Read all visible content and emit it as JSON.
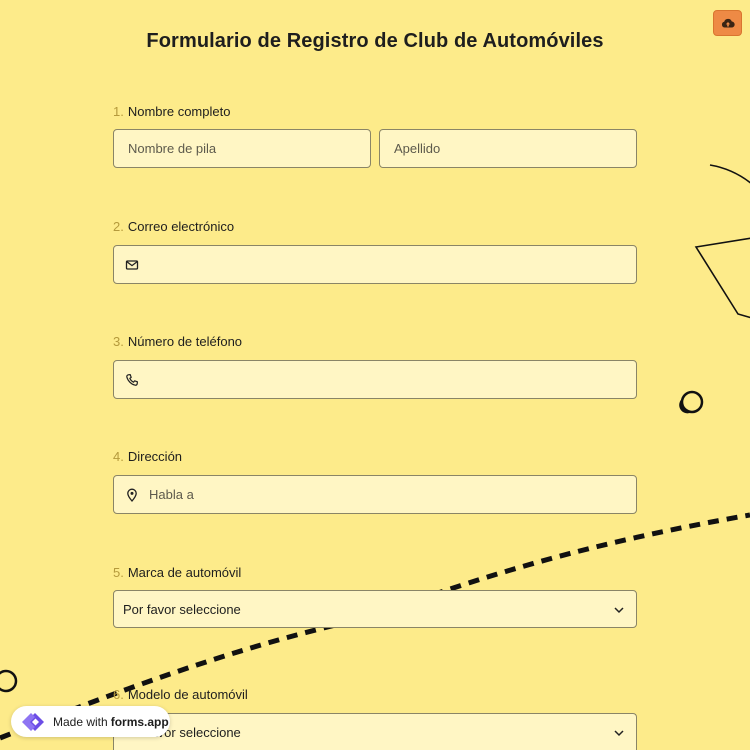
{
  "title": "Formulario de Registro de Club de Automóviles",
  "colors": {
    "background": "#fdeb8a",
    "field_bg": "#fff6c4",
    "accent": "#ee8a45",
    "number": "#b59a3c"
  },
  "top_button": {
    "icon": "cloud-upload-icon"
  },
  "fields": [
    {
      "number": "1.",
      "label": "Nombre completo",
      "first_placeholder": "Nombre de pila",
      "last_placeholder": "Apellido"
    },
    {
      "number": "2.",
      "label": "Correo electrónico",
      "icon": "envelope-icon"
    },
    {
      "number": "3.",
      "label": "Número de teléfono",
      "icon": "phone-icon"
    },
    {
      "number": "4.",
      "label": "Dirección",
      "icon": "map-pin-icon",
      "placeholder": "Habla a"
    },
    {
      "number": "5.",
      "label": "Marca de automóvil",
      "selected": "Por favor seleccione"
    },
    {
      "number": "6.",
      "label": "Modelo de automóvil",
      "selected": "Por favor seleccione"
    }
  ],
  "badge": {
    "prefix": "Made with",
    "brand": "forms.app"
  }
}
